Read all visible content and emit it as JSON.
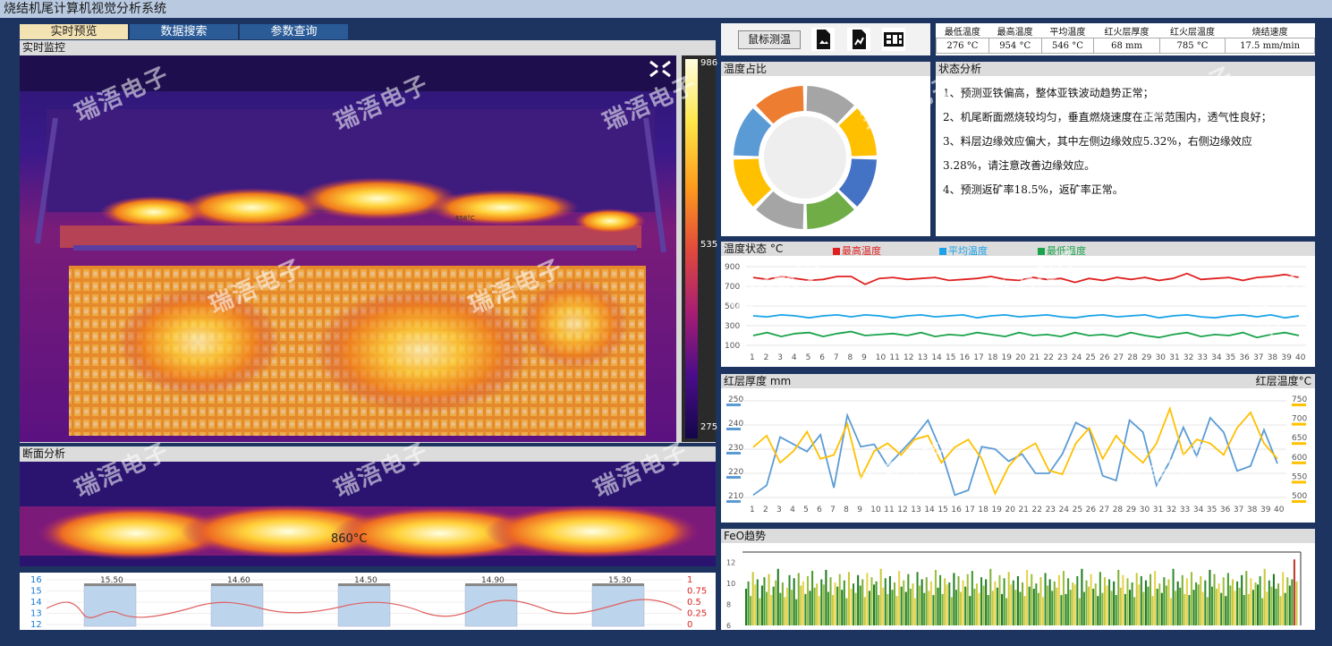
{
  "window": {
    "title": "烧结机尾计算机视觉分析系统"
  },
  "tabs": [
    {
      "label": "实时预览",
      "active": true
    },
    {
      "label": "数据搜索",
      "active": false
    },
    {
      "label": "参数查询",
      "active": false
    }
  ],
  "monitor": {
    "header": "实时监控",
    "hotspot_label": "658°C",
    "colorbar": {
      "max": "986",
      "mid": "535",
      "min": "275"
    }
  },
  "section": {
    "header": "断面分析",
    "temp_label": "860°C"
  },
  "bottom_chart": {
    "left_ticks": [
      "16",
      "15",
      "14",
      "13",
      "12"
    ],
    "right_ticks": [
      "1",
      "0.75",
      "0.5",
      "0.25",
      "0"
    ],
    "box_labels": [
      "15.50",
      "14.60",
      "14.50",
      "14.90",
      "15.30"
    ]
  },
  "toolbar": {
    "measure_button": "鼠标测温",
    "icons": [
      "image-export-icon",
      "chart-export-icon",
      "video-icon"
    ]
  },
  "stats": {
    "headers": [
      "最低温度",
      "最高温度",
      "平均温度",
      "红火层厚度",
      "红火层温度",
      "烧结速度"
    ],
    "values": [
      "276 °C",
      "954 °C",
      "546 °C",
      "68 mm",
      "785 °C",
      "17.5 mm/min"
    ]
  },
  "temp_ratio": {
    "header": "温度占比",
    "segments": [
      {
        "color": "#a5a5a5",
        "value": 1
      },
      {
        "color": "#ffc000",
        "value": 1
      },
      {
        "color": "#4472c4",
        "value": 1
      },
      {
        "color": "#70ad47",
        "value": 1
      },
      {
        "color": "#a5a5a5",
        "value": 1
      },
      {
        "color": "#ffc000",
        "value": 1
      },
      {
        "color": "#5b9bd5",
        "value": 1
      },
      {
        "color": "#ed7d31",
        "value": 1
      }
    ]
  },
  "status_analysis": {
    "header": "状态分析",
    "lines": [
      "1、预测亚铁偏高，整体亚铁波动趋势正常；",
      "2、机尾断面燃烧较均匀，垂直燃烧速度在正常范围内，透气性良好；",
      "3、料层边缘效应偏大，其中左侧边缘效应5.32%，右侧边缘效应",
      "3.28%，请注意改善边缘效应。",
      "4、预测返矿率18.5%，返矿率正常。"
    ]
  },
  "temp_status": {
    "header": "温度状态 °C",
    "legend": [
      {
        "name": "最高温度",
        "color": "#e02020"
      },
      {
        "name": "平均温度",
        "color": "#1aa3e8"
      },
      {
        "name": "最低温度",
        "color": "#1aa34a"
      }
    ]
  },
  "red_layer": {
    "header_left": "红层厚度 mm",
    "header_right": "红层温度°C"
  },
  "feo": {
    "header": "FeO趋势"
  },
  "watermark_text": "瑞浯电子",
  "colors": {
    "background": "#1d3461",
    "tab_active": "#f4e3b2",
    "tab": "#2a5b97"
  },
  "chart_data": [
    {
      "type": "line",
      "title": "温度状态 °C",
      "categories": [
        1,
        2,
        3,
        4,
        5,
        6,
        7,
        8,
        9,
        10,
        11,
        12,
        13,
        14,
        15,
        16,
        17,
        18,
        19,
        20,
        21,
        22,
        23,
        24,
        25,
        26,
        27,
        28,
        29,
        30,
        31,
        32,
        33,
        34,
        35,
        36,
        37,
        38,
        39,
        40
      ],
      "ylim": [
        100,
        900
      ],
      "y_ticks": [
        900,
        700,
        500,
        300,
        100
      ],
      "series": [
        {
          "name": "最高温度",
          "color": "#e02020",
          "values": [
            790,
            770,
            800,
            780,
            760,
            770,
            800,
            800,
            720,
            780,
            790,
            770,
            780,
            790,
            760,
            770,
            780,
            800,
            770,
            760,
            790,
            770,
            780,
            740,
            780,
            760,
            790,
            770,
            790,
            760,
            780,
            830,
            770,
            780,
            790,
            760,
            790,
            800,
            820,
            790
          ]
        },
        {
          "name": "平均温度",
          "color": "#1aa3e8",
          "values": [
            400,
            390,
            410,
            400,
            380,
            400,
            410,
            390,
            410,
            400,
            380,
            400,
            410,
            390,
            400,
            410,
            380,
            400,
            410,
            390,
            400,
            410,
            390,
            380,
            400,
            410,
            390,
            400,
            410,
            380,
            400,
            410,
            390,
            380,
            400,
            410,
            390,
            410,
            380,
            400
          ]
        },
        {
          "name": "最低温度",
          "color": "#1aa34a",
          "values": [
            200,
            230,
            190,
            220,
            230,
            190,
            220,
            240,
            200,
            210,
            220,
            200,
            230,
            190,
            210,
            200,
            230,
            210,
            190,
            230,
            200,
            210,
            190,
            230,
            200,
            210,
            190,
            230,
            200,
            180,
            210,
            230,
            190,
            210,
            200,
            230,
            180,
            210,
            230,
            200
          ]
        }
      ]
    },
    {
      "type": "line",
      "title": "红层厚度 mm / 红层温度°C",
      "categories": [
        1,
        2,
        3,
        4,
        5,
        6,
        7,
        8,
        9,
        10,
        11,
        12,
        13,
        14,
        15,
        16,
        17,
        18,
        19,
        20,
        21,
        22,
        23,
        24,
        25,
        26,
        27,
        28,
        29,
        30,
        31,
        32,
        33,
        34,
        35,
        36,
        37,
        38,
        39,
        40
      ],
      "y_left_lim": [
        210,
        250
      ],
      "y_left_ticks": [
        250,
        240,
        230,
        220,
        210
      ],
      "y_right_lim": [
        500,
        750
      ],
      "y_right_ticks": [
        750,
        700,
        650,
        600,
        550,
        500
      ],
      "series": [
        {
          "name": "红层厚度",
          "axis": "left",
          "color": "#5b9bd5",
          "values": [
            211,
            215,
            235,
            232,
            229,
            236,
            214,
            244,
            231,
            232,
            223,
            229,
            235,
            242,
            229,
            211,
            213,
            231,
            230,
            225,
            228,
            220,
            220,
            228,
            241,
            238,
            219,
            217,
            242,
            237,
            215,
            225,
            239,
            227,
            243,
            237,
            221,
            223,
            238,
            224
          ]
        },
        {
          "name": "红层温度",
          "axis": "right",
          "color": "#ffc000",
          "values": [
            630,
            660,
            590,
            620,
            670,
            600,
            610,
            690,
            550,
            620,
            640,
            610,
            650,
            660,
            590,
            630,
            650,
            600,
            510,
            580,
            620,
            640,
            570,
            560,
            640,
            680,
            600,
            660,
            620,
            590,
            640,
            730,
            610,
            650,
            640,
            610,
            680,
            720,
            640,
            600
          ]
        }
      ]
    },
    {
      "type": "bar",
      "title": "FeO趋势",
      "ylim": [
        6,
        13
      ],
      "y_ticks": [
        12,
        10,
        8,
        6
      ],
      "count": 240,
      "series": [
        {
          "name": "FeO",
          "values": [
            9.5,
            10.2,
            8.8,
            11.1,
            9.9,
            10.4,
            8.6,
            9.8,
            10.6,
            9.2,
            10.9,
            8.9,
            9.7,
            10.3,
            11.4,
            9.1,
            10.1,
            8.7,
            9.6,
            10.8,
            9.4,
            10.5,
            8.5,
            11.0,
            9.8,
            10.2,
            9.0,
            10.7,
            9.3,
            11.2,
            9.6,
            10.0,
            8.8,
            10.4,
            9.9,
            11.3,
            9.2,
            10.6,
            8.9,
            10.1,
            9.7,
            10.9,
            9.4,
            10.3,
            8.6,
            11.1,
            9.5,
            10.0,
            9.1,
            10.8,
            9.8,
            10.4,
            8.7,
            11.0,
            9.3,
            10.6,
            9.9,
            10.2,
            8.9,
            11.4,
            9.6,
            10.5,
            9.0,
            10.7,
            9.4,
            10.1,
            8.8,
            11.2,
            9.7,
            10.3,
            9.2,
            10.9,
            9.5,
            10.0,
            8.6,
            11.1,
            9.8,
            10.4,
            9.1,
            10.6,
            9.3,
            10.2,
            8.9,
            11.3,
            9.6,
            10.8,
            9.0,
            10.5,
            9.9,
            10.1,
            8.7,
            11.0,
            9.4,
            10.7,
            9.2,
            10.3,
            9.7,
            10.9,
            8.8,
            11.2,
            9.5,
            10.0,
            9.1,
            10.6,
            9.8,
            10.4,
            8.9,
            11.4,
            9.3,
            10.2,
            9.6,
            10.8,
            9.0,
            10.5,
            8.6,
            11.1,
            9.9,
            10.3,
            9.4,
            10.7,
            9.2,
            10.1,
            8.8,
            11.3,
            9.7,
            10.9,
            9.5,
            10.0,
            9.1,
            10.6,
            8.7,
            11.0,
            9.8,
            10.4,
            9.3,
            10.2,
            9.6,
            10.8,
            8.9,
            11.2,
            9.0,
            10.5,
            9.4,
            10.1,
            9.9,
            10.7,
            8.6,
            11.4,
            9.2,
            10.3,
            9.7,
            10.9,
            9.5,
            10.0,
            8.8,
            11.1,
            9.1,
            10.6,
            9.8,
            10.4,
            9.3,
            10.2,
            8.9,
            11.3,
            9.6,
            10.8,
            9.0,
            10.5,
            9.4,
            10.1,
            8.7,
            11.0,
            9.9,
            10.7,
            9.2,
            10.3,
            9.7,
            10.9,
            8.8,
            11.2,
            9.5,
            10.0,
            9.1,
            10.6,
            9.8,
            10.4,
            8.6,
            11.4,
            9.3,
            10.2,
            9.6,
            10.8,
            9.0,
            10.5,
            8.9,
            11.1,
            9.4,
            10.1,
            9.9,
            10.7,
            9.2,
            10.3,
            8.7,
            11.3,
            9.7,
            10.9,
            9.5,
            10.0,
            9.1,
            10.6,
            8.8,
            11.0,
            9.8,
            10.4,
            9.3,
            10.2,
            9.6,
            10.8,
            8.9,
            11.2,
            9.0,
            10.5,
            9.4,
            10.1,
            9.9,
            10.7,
            8.6,
            11.4,
            9.2,
            10.3,
            9.7,
            10.9,
            9.5,
            10.0,
            8.8,
            11.1,
            9.1,
            10.6,
            9.8,
            10.4,
            12.3,
            10.2
          ]
        }
      ]
    }
  ]
}
